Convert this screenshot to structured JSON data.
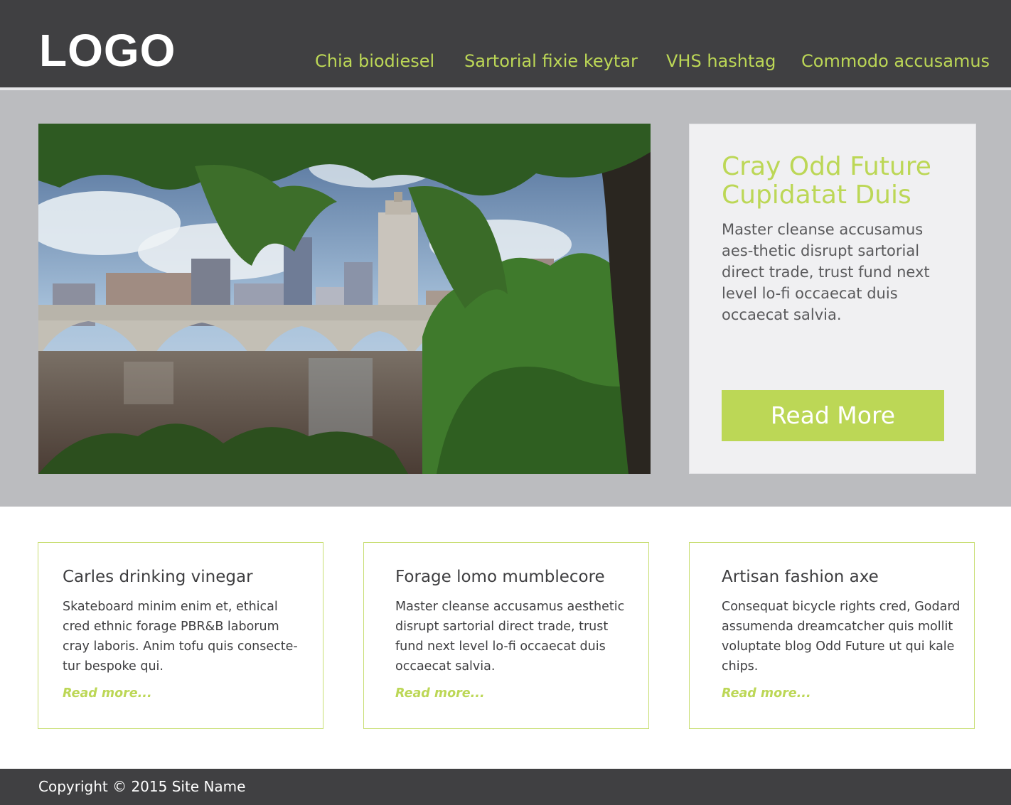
{
  "header": {
    "logo": "LOGO",
    "nav": [
      "Chia biodiesel",
      "Sartorial fixie keytar",
      "VHS hashtag",
      "Commodo accusamus"
    ]
  },
  "hero": {
    "title": "Cray Odd Future Cupidatat Duis",
    "text": "Master cleanse accusamus aes-thetic disrupt sartorial direct trade, trust fund next level lo-fi occaecat duis occaecat salvia.",
    "button": "Read More"
  },
  "cards": [
    {
      "title": "Carles drinking vinegar",
      "text": "Skateboard minim enim et, ethical cred ethnic forage PBR&B laborum cray laboris. Anim tofu quis consecte-tur bespoke qui.",
      "link": "Read more..."
    },
    {
      "title": "Forage lomo mumblecore",
      "text": "Master cleanse accusamus aesthetic disrupt sartorial direct trade, trust fund next level lo-fi occaecat duis occaecat salvia.",
      "link": "Read more..."
    },
    {
      "title": "Artisan fashion axe",
      "text": "Consequat bicycle rights cred, Godard assumenda dreamcatcher quis mollit voluptate blog Odd Future ut qui kale chips.",
      "link": "Read more..."
    }
  ],
  "footer": {
    "copyright": "Copyright © 2015 Site Name"
  },
  "colors": {
    "accent": "#bcd756",
    "header_bg": "#404042",
    "hero_bg": "#bbbcbf",
    "panel_bg": "#f0f0f2"
  }
}
